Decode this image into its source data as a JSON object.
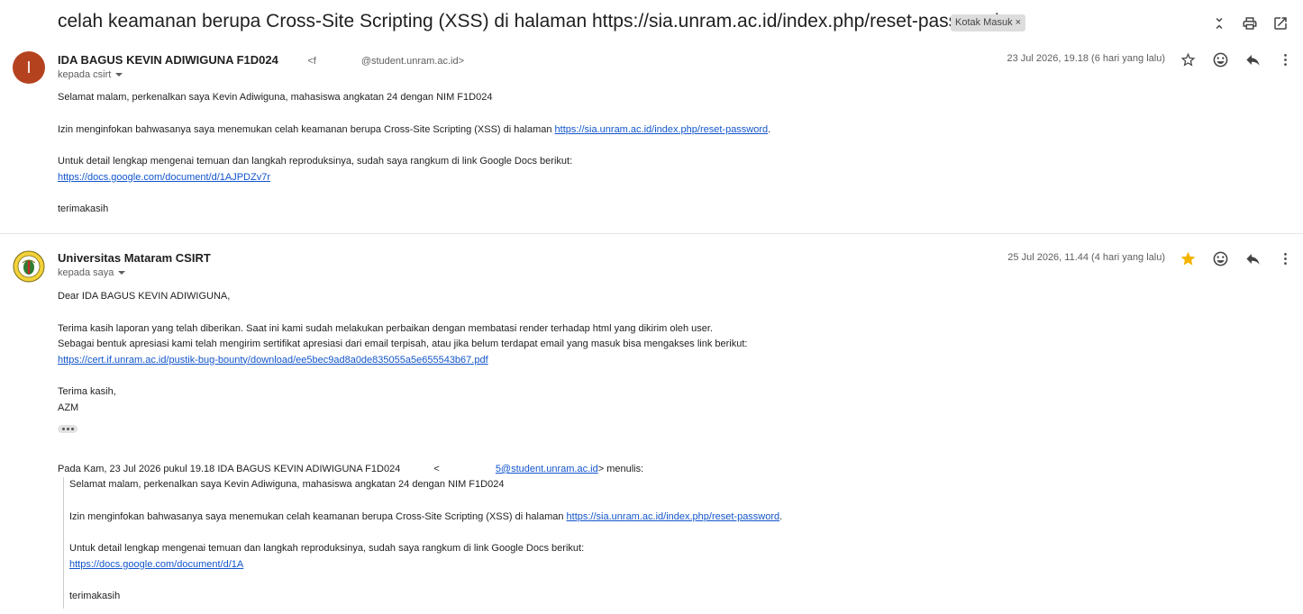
{
  "thread": {
    "subject": "celah keamanan berupa Cross-Site Scripting (XSS) di halaman https://sia.unram.ac.id/index.php/reset-password",
    "label": "Kotak Masuk",
    "label_close": "×"
  },
  "messages": [
    {
      "avatar_letter": "I",
      "sender_name": "IDA BAGUS KEVIN ADIWIGUNA F1D024",
      "sender_email_prefix": "<f",
      "sender_email_suffix": "@student.unram.ac.id>",
      "to_text": "kepada csirt",
      "date": "23 Jul 2026, 19.18 (6 hari yang lalu)",
      "starred": false,
      "body": {
        "greeting": "Selamat malam, perkenalkan saya Kevin Adiwiguna, mahasiswa angkatan 24 dengan NIM F1D024",
        "line2_prefix": "Izin menginfokan bahwasanya saya menemukan celah keamanan berupa Cross-Site Scripting (XSS) di halaman ",
        "line2_link": "https://sia.unram.ac.id/index.php/reset-password",
        "line2_suffix": ".",
        "line3": "Untuk detail lengkap mengenai temuan dan langkah reproduksinya, sudah saya rangkum di link Google Docs berikut:",
        "docs_link": "https://docs.google.com/document/d/1AJPDZv7r",
        "closing": "terimakasih"
      }
    },
    {
      "sender_name": "Universitas Mataram CSIRT",
      "to_text": "kepada saya",
      "date": "25 Jul 2026, 11.44 (4 hari yang lalu)",
      "starred": true,
      "body": {
        "greeting": "Dear  IDA BAGUS KEVIN ADIWIGUNA,",
        "line1": "Terima kasih laporan yang telah diberikan. Saat ini kami sudah melakukan perbaikan dengan membatasi render terhadap html yang dikirim oleh user.",
        "line2": "Sebagai bentuk apresiasi kami telah mengirim sertifikat apresiasi dari email terpisah, atau jika belum terdapat email yang masuk bisa mengakses link berikut:",
        "cert_link": "https://cert.if.unram.ac.id/pustik-bug-bounty/download/ee5bec9ad8a0de835055a5e655543b67.pdf",
        "signoff": "Terima kasih,",
        "signature": "AZM"
      },
      "quote_header_prefix": "Pada Kam, 23 Jul 2026 pukul 19.18 IDA BAGUS KEVIN ADIWIGUNA F1D024",
      "quote_header_email_open": "<",
      "quote_header_email_link": "5@student.unram.ac.id",
      "quote_header_suffix": "> menulis:",
      "quoted": {
        "greeting": "Selamat malam, perkenalkan saya Kevin Adiwiguna, mahasiswa angkatan 24 dengan NIM F1D024",
        "line2_prefix": "Izin menginfokan bahwasanya saya menemukan celah keamanan berupa Cross-Site Scripting (XSS) di halaman ",
        "line2_link": "https://sia.unram.ac.id/index.php/reset-password",
        "line2_suffix": ".",
        "line3": "Untuk detail lengkap mengenai temuan dan langkah reproduksinya, sudah saya rangkum di link Google Docs berikut:",
        "docs_link": "https://docs.google.com/document/d/1A",
        "closing": "terimakasih"
      }
    }
  ],
  "icons": {
    "collapse": "unfold-less-icon",
    "print": "print-icon",
    "open_new": "open-in-new-icon",
    "star": "star-icon",
    "emoji": "emoji-reaction-icon",
    "reply": "reply-icon",
    "more": "more-vert-icon"
  },
  "colors": {
    "avatar": "#b5421f",
    "star_active": "#f4b400",
    "link": "#1155cc"
  }
}
